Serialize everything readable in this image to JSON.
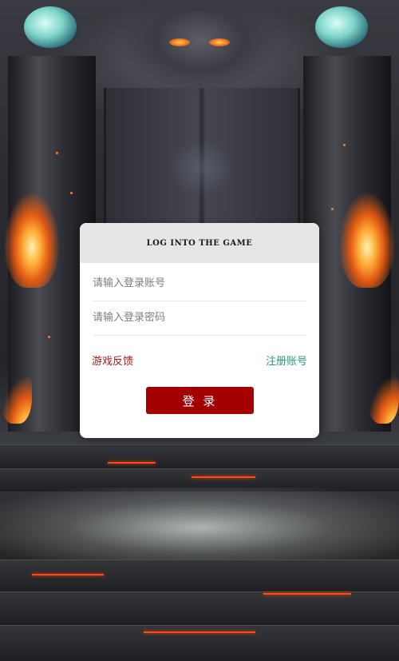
{
  "login": {
    "title": "LOG INTO THE GAME",
    "account": {
      "placeholder": "请输入登录账号",
      "value": ""
    },
    "password": {
      "placeholder": "请输入登录密码",
      "value": ""
    },
    "feedback_link": "游戏反馈",
    "register_link": "注册账号",
    "submit_label": "登 录"
  },
  "colors": {
    "header_bg": "#e6e6e6",
    "feedback_link": "#a11b1b",
    "register_link": "#2b9a74",
    "submit_bg": "#a50000"
  }
}
